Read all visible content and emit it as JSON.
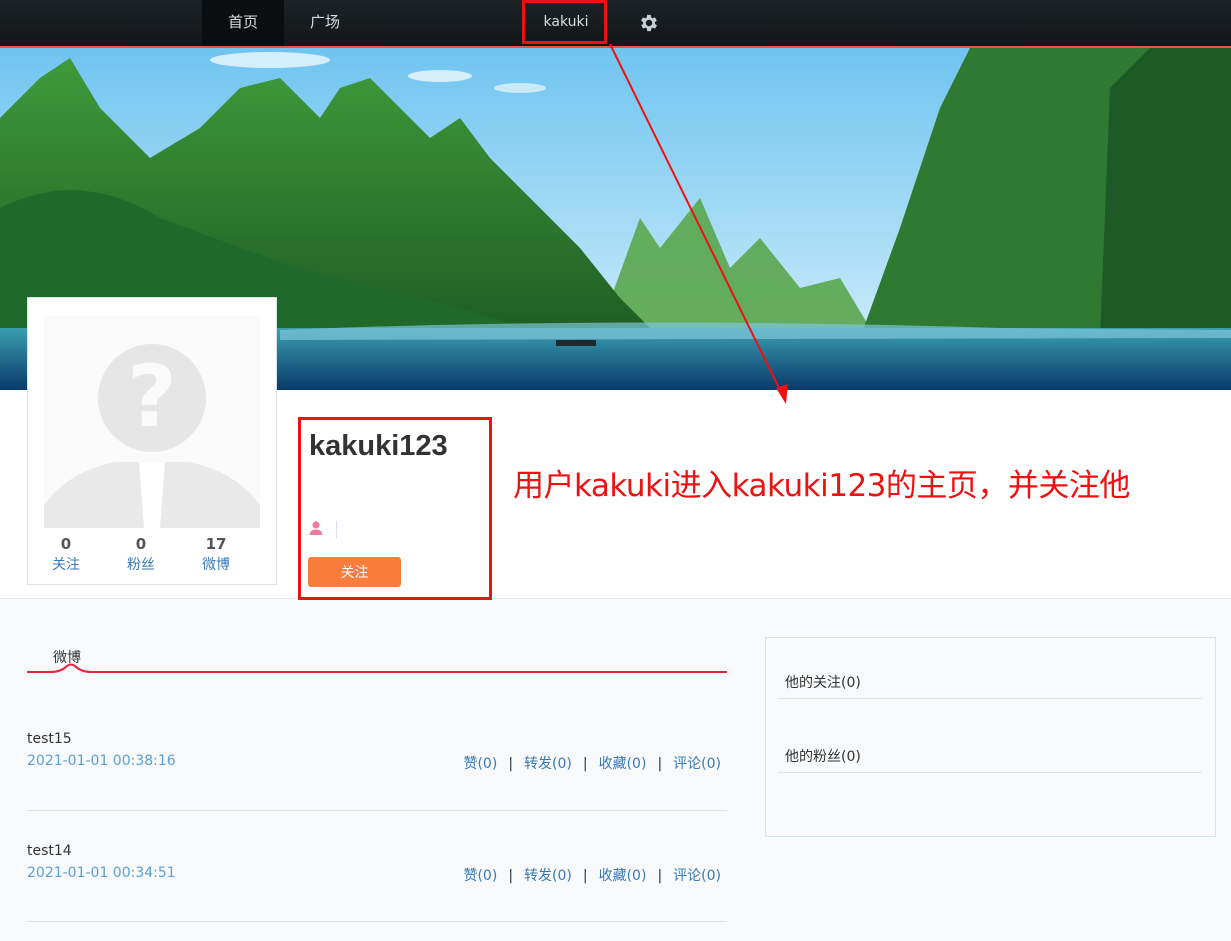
{
  "nav": {
    "home": "首页",
    "square": "广场",
    "current_user": "kakuki",
    "settings_icon": "gear-icon"
  },
  "profile": {
    "username": "kakuki123",
    "follow_button": "关注",
    "stats": [
      {
        "value": "0",
        "label": "关注"
      },
      {
        "value": "0",
        "label": "粉丝"
      },
      {
        "value": "17",
        "label": "微博"
      }
    ]
  },
  "annotation": {
    "text": "用户kakuki进入kakuki123的主页，并关注他",
    "color": "#ee1111"
  },
  "feed": {
    "tab": "微博",
    "posts": [
      {
        "text": "test15",
        "time": "2021-01-01 00:38:16",
        "like": "赞(0)",
        "repost": "转发(0)",
        "favorite": "收藏(0)",
        "comment": "评论(0)"
      },
      {
        "text": "test14",
        "time": "2021-01-01 00:34:51",
        "like": "赞(0)",
        "repost": "转发(0)",
        "favorite": "收藏(0)",
        "comment": "评论(0)"
      }
    ]
  },
  "sidebar": {
    "following": "他的关注(0)",
    "followers": "他的粉丝(0)"
  },
  "colors": {
    "accent_orange": "#fa7d3c",
    "link_blue": "#3a7ab8",
    "timestamp_blue": "#5aa0d6",
    "tab_underline_red": "#e0283a"
  }
}
